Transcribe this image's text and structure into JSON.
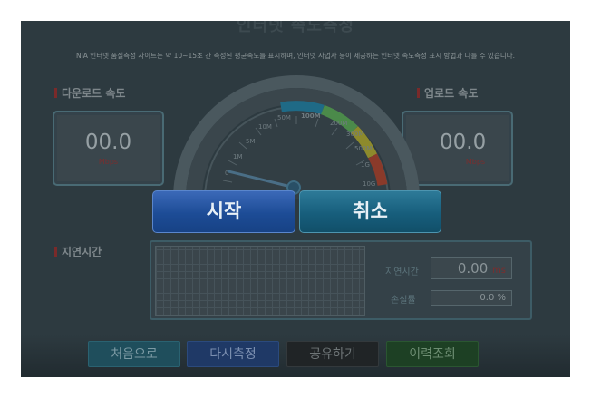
{
  "page": {
    "title": "인터넷 속도측정",
    "notice": "NIA 인터넷 품질측정 사이트는 약 10~15초 간 측정된 평균속도를 표시하며, 인터넷 사업자 등이 제공하는 인터넷 속도측정 표시 방법과 다를 수 있습니다."
  },
  "download": {
    "label": "다운로드 속도",
    "value": "00.0",
    "unit": "Mbps"
  },
  "upload": {
    "label": "업로드 속도",
    "value": "00.0",
    "unit": "Mbps"
  },
  "gauge": {
    "ticks": [
      "0",
      "1M",
      "5M",
      "10M",
      "50M",
      "100M",
      "200M",
      "300M",
      "500M",
      "1G",
      "10G"
    ],
    "needle_value": "0"
  },
  "buttons": {
    "start": "시작",
    "cancel": "취소"
  },
  "latency": {
    "section_label": "지연시간",
    "latency_label": "지연시간",
    "latency_value": "0.00",
    "latency_unit": "ms",
    "loss_label": "손실률",
    "loss_value": "0.0 %"
  },
  "footer": {
    "home": "처음으로",
    "retest": "다시측정",
    "share": "공유하기",
    "history": "이력조회"
  },
  "colors": {
    "start_button": "#1d4c96",
    "cancel_button": "#175e7c",
    "history_button": "#1d4024",
    "overlay": "#2d3a40"
  }
}
